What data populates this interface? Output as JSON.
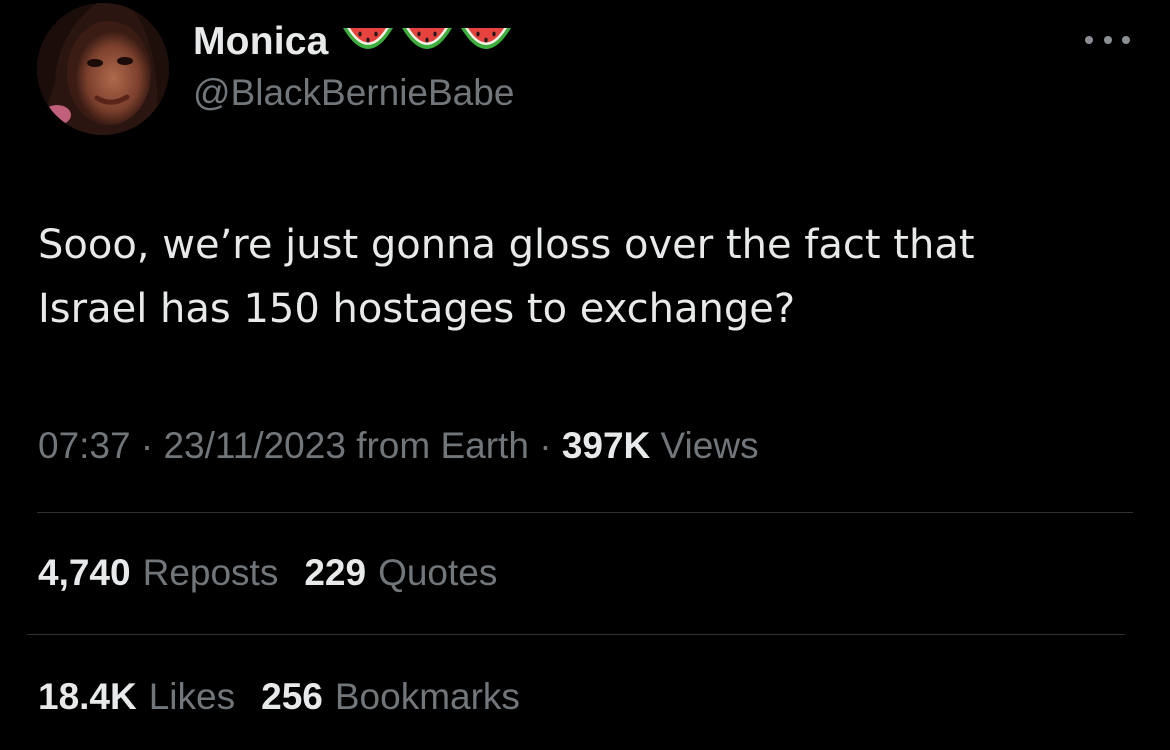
{
  "author": {
    "display_name": "Monica",
    "handle": "@BlackBernieBabe",
    "name_emojis": [
      "watermelon-emoji",
      "watermelon-emoji",
      "watermelon-emoji"
    ]
  },
  "tweet": {
    "text": "Sooo, we’re just gonna gloss over the fact that\nIsrael has 150 hostages to exchange?"
  },
  "meta": {
    "time": "07:37",
    "separator_1": "·",
    "date": "23/11/2023",
    "source": "from Earth",
    "separator_2": "·",
    "views_count": "397K",
    "views_label": "Views"
  },
  "stats": {
    "reposts_count": "4,740",
    "reposts_label": "Reposts",
    "quotes_count": "229",
    "quotes_label": "Quotes",
    "likes_count": "18.4K",
    "likes_label": "Likes",
    "bookmarks_count": "256",
    "bookmarks_label": "Bookmarks"
  },
  "colors": {
    "background": "#000000",
    "primary_text": "#e7e9ea",
    "secondary_text": "#71767b",
    "divider": "#2f3336",
    "watermelon_rind": "#3cae3c",
    "watermelon_flesh": "#e8423f"
  }
}
